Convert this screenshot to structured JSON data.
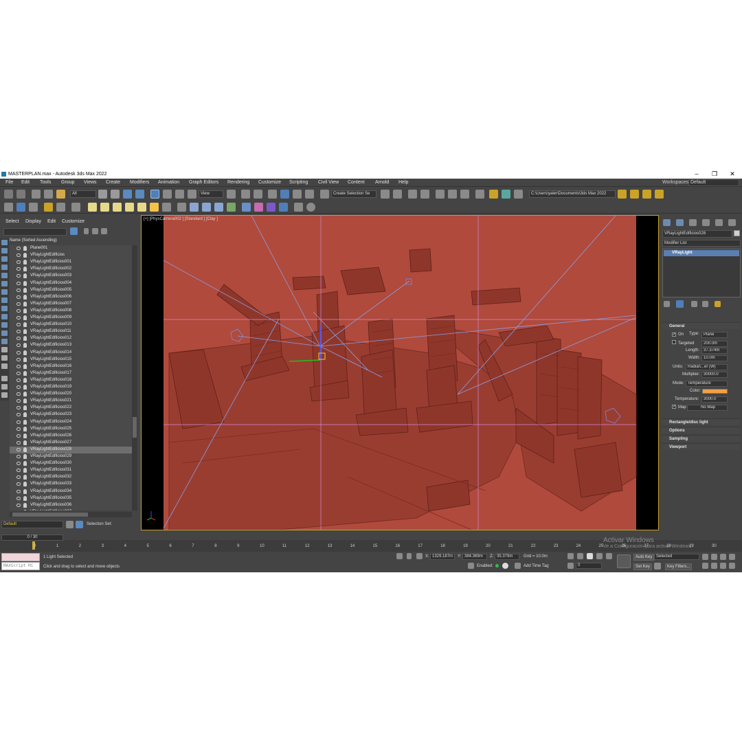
{
  "window": {
    "title": "MASTERPLAN.max - Autodesk 3ds Max 2022",
    "minimize": "‒",
    "maximize": "❐",
    "close": "✕"
  },
  "menu": {
    "items": [
      "File",
      "Edit",
      "Tools",
      "Group",
      "Views",
      "Create",
      "Modifiers",
      "Animation",
      "Graph Editors",
      "Rendering",
      "Customize",
      "Scripting",
      "Civil View",
      "Content",
      "Arnold",
      "Help"
    ],
    "workspaces_label": "Workspaces:",
    "workspace_value": "Default"
  },
  "toolbar": {
    "filter_value": "All",
    "view_value": "View",
    "selection_set_placeholder": "Create Selection Se",
    "project_path": "C:\\Users\\yaler\\Documents\\3ds Max 2022"
  },
  "scene_explorer": {
    "tabs": [
      "Select",
      "Display",
      "Edit",
      "Customize"
    ],
    "column_header": "Name (Sorted Ascending)",
    "items": [
      "Plane001",
      "VRayLightEdificios",
      "VRayLightEdificios001",
      "VRayLightEdificios002",
      "VRayLightEdificios003",
      "VRayLightEdificios004",
      "VRayLightEdificios005",
      "VRayLightEdificios006",
      "VRayLightEdificios007",
      "VRayLightEdificios008",
      "VRayLightEdificios009",
      "VRayLightEdificios010",
      "VRayLightEdificios011",
      "VRayLightEdificios012",
      "VRayLightEdificios013",
      "VRayLightEdificios014",
      "VRayLightEdificios015",
      "VRayLightEdificios016",
      "VRayLightEdificios017",
      "VRayLightEdificios018",
      "VRayLightEdificios019",
      "VRayLightEdificios020",
      "VRayLightEdificios021",
      "VRayLightEdificios022",
      "VRayLightEdificios023",
      "VRayLightEdificios024",
      "VRayLightEdificios025",
      "VRayLightEdificios026",
      "VRayLightEdificios027",
      "VRayLightEdificios028",
      "VRayLightEdificios029",
      "VRayLightEdificios030",
      "VRayLightEdificios031",
      "VRayLightEdificios032",
      "VRayLightEdificios033",
      "VRayLightEdificios034",
      "VRayLightEdificios035",
      "VRayLightEdificios036",
      "VRayLightEdificios037"
    ],
    "selected_item": "VRayLightEdificios028",
    "layer_value": "Default",
    "selection_set_label": "Selection Set:"
  },
  "viewport": {
    "label": "[+] [PhysCamera002 ] [Standard ] [Clay ]"
  },
  "command_panel": {
    "object_name": "VRayLightEdificios028",
    "modifier_list": "Modifier List",
    "stack_item": "VRayLight",
    "general_title": "General",
    "on_label": "On",
    "type_label": "Type:",
    "type_value": "Plane",
    "targeted_label": "Targeted",
    "targeted_value": "200.0m",
    "length_label": "Length:",
    "length_value": "37.374m",
    "width_label": "Width:",
    "width_value": "10.0m",
    "units_label": "Units:",
    "units_value": "Radian...er (W)",
    "multiplier_label": "Multiplier:",
    "multiplier_value": "30000.0",
    "mode_label": "Mode:",
    "mode_value": "Temperature",
    "color_label": "Color:",
    "color_hex": "#f5a040",
    "temperature_label": "Temperature:",
    "temperature_value": "3000.0",
    "map_label": "Map",
    "map_value": "No Map",
    "rollouts": [
      "Rectangle/disc light",
      "Options",
      "Sampling",
      "Viewport"
    ]
  },
  "timeline": {
    "frame_display": "0 / 30",
    "ticks": [
      "0",
      "1",
      "2",
      "3",
      "4",
      "5",
      "6",
      "7",
      "8",
      "9",
      "10",
      "11",
      "12",
      "13",
      "14",
      "15",
      "16",
      "17",
      "18",
      "19",
      "20",
      "21",
      "22",
      "23",
      "24",
      "25",
      "26",
      "27",
      "28",
      "29",
      "30"
    ]
  },
  "status": {
    "maxscript_label": "MAXScript Mi",
    "selection_status": "1 Light Selected",
    "prompt": "Click and drag to select and move objects",
    "x_label": "X:",
    "x_value": "1329.187m",
    "y_label": "Y:",
    "y_value": "384.369m",
    "z_label": "Z:",
    "z_value": "35.379m",
    "grid": "Grid = 10.0m",
    "enabled_label": "Enabled:",
    "add_time_tag": "Add Time Tag",
    "auto_key": "Auto Key",
    "selected_value": "Selected",
    "set_key": "Set Key",
    "key_filters": "Key Filters...",
    "frame_value": "0"
  },
  "watermark": {
    "line1": "Activar Windows",
    "line2": "Ve a Configuración para activar Windows."
  }
}
